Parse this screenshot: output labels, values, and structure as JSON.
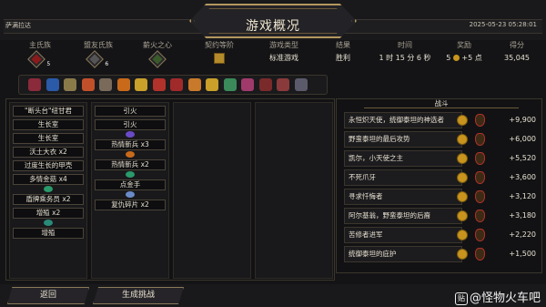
{
  "header": {
    "player": "萨满拉达",
    "title": "游戏概况",
    "datetime": "2025-05-23 05:28:01"
  },
  "stats": {
    "primary_clan": {
      "label": "主氏族",
      "tier": "5"
    },
    "allied_clan": {
      "label": "盟友氏族",
      "tier": "6"
    },
    "pyre_heart": {
      "label": "薪火之心"
    },
    "covenant": {
      "label": "契约等阶"
    },
    "game_type": {
      "label": "游戏类型",
      "value": "标准游戏"
    },
    "result": {
      "label": "结果",
      "value": "胜利"
    },
    "time": {
      "label": "时间",
      "value": "1 时 15 分 6 秒"
    },
    "reward": {
      "label": "奖励",
      "value": "5",
      "suffix": "+5 点"
    },
    "score": {
      "label": "得分",
      "value": "35,045"
    }
  },
  "relics": [
    {
      "name": "relic-1",
      "color": "#8a2a3a"
    },
    {
      "name": "relic-2",
      "color": "#2a5aa8"
    },
    {
      "name": "relic-3",
      "color": "#8a7a4a"
    },
    {
      "name": "relic-4",
      "color": "#c0502a"
    },
    {
      "name": "relic-5",
      "color": "#7a6a5a"
    },
    {
      "name": "relic-6",
      "color": "#c86a1a"
    },
    {
      "name": "relic-7",
      "color": "#c8a02a"
    },
    {
      "name": "relic-8",
      "color": "#b0322a"
    },
    {
      "name": "relic-9",
      "color": "#a02a2a"
    },
    {
      "name": "relic-10",
      "color": "#c87a2a"
    },
    {
      "name": "relic-11",
      "color": "#c8a02a"
    },
    {
      "name": "relic-12",
      "color": "#3a8a5a"
    },
    {
      "name": "relic-13",
      "color": "#a03a6a"
    },
    {
      "name": "relic-14",
      "color": "#7a2a2a"
    },
    {
      "name": "relic-15",
      "color": "#8a3a3a"
    },
    {
      "name": "relic-16",
      "color": "#5a5a6a"
    }
  ],
  "deck": {
    "col1": [
      "\"断头台\"纽甘君",
      "生长室",
      "生长室",
      "沃土大衣 x2",
      "过度生长的甲壳",
      "多情金菇 x4",
      "盾牌乘务员 x2",
      "增殖 x2",
      "增殖"
    ],
    "col2": [
      "引火",
      "引火",
      "热情新兵 x3",
      "热情新兵 x2",
      "点金手",
      "复仇碎片 x2"
    ]
  },
  "battle": {
    "header": "战斗",
    "rows": [
      {
        "name": "永恒炽天使，统御泰坦的神选者",
        "score": "+9,900"
      },
      {
        "name": "野蛮泰坦的最后攻势",
        "score": "+6,000"
      },
      {
        "name": "凯尔，小天使之主",
        "score": "+5,520"
      },
      {
        "name": "不死爪牙",
        "score": "+3,600"
      },
      {
        "name": "寻求忏悔者",
        "score": "+3,120"
      },
      {
        "name": "阿尔基翁，野蛮泰坦的后裔",
        "score": "+3,180"
      },
      {
        "name": "苦修者进军",
        "score": "+2,220"
      },
      {
        "name": "统御泰坦的庇护",
        "score": "+1,500"
      }
    ]
  },
  "buttons": {
    "back": "返回",
    "generate": "生成挑战"
  },
  "watermark": {
    "icon": "贴",
    "text": "@怪物火车吧"
  }
}
